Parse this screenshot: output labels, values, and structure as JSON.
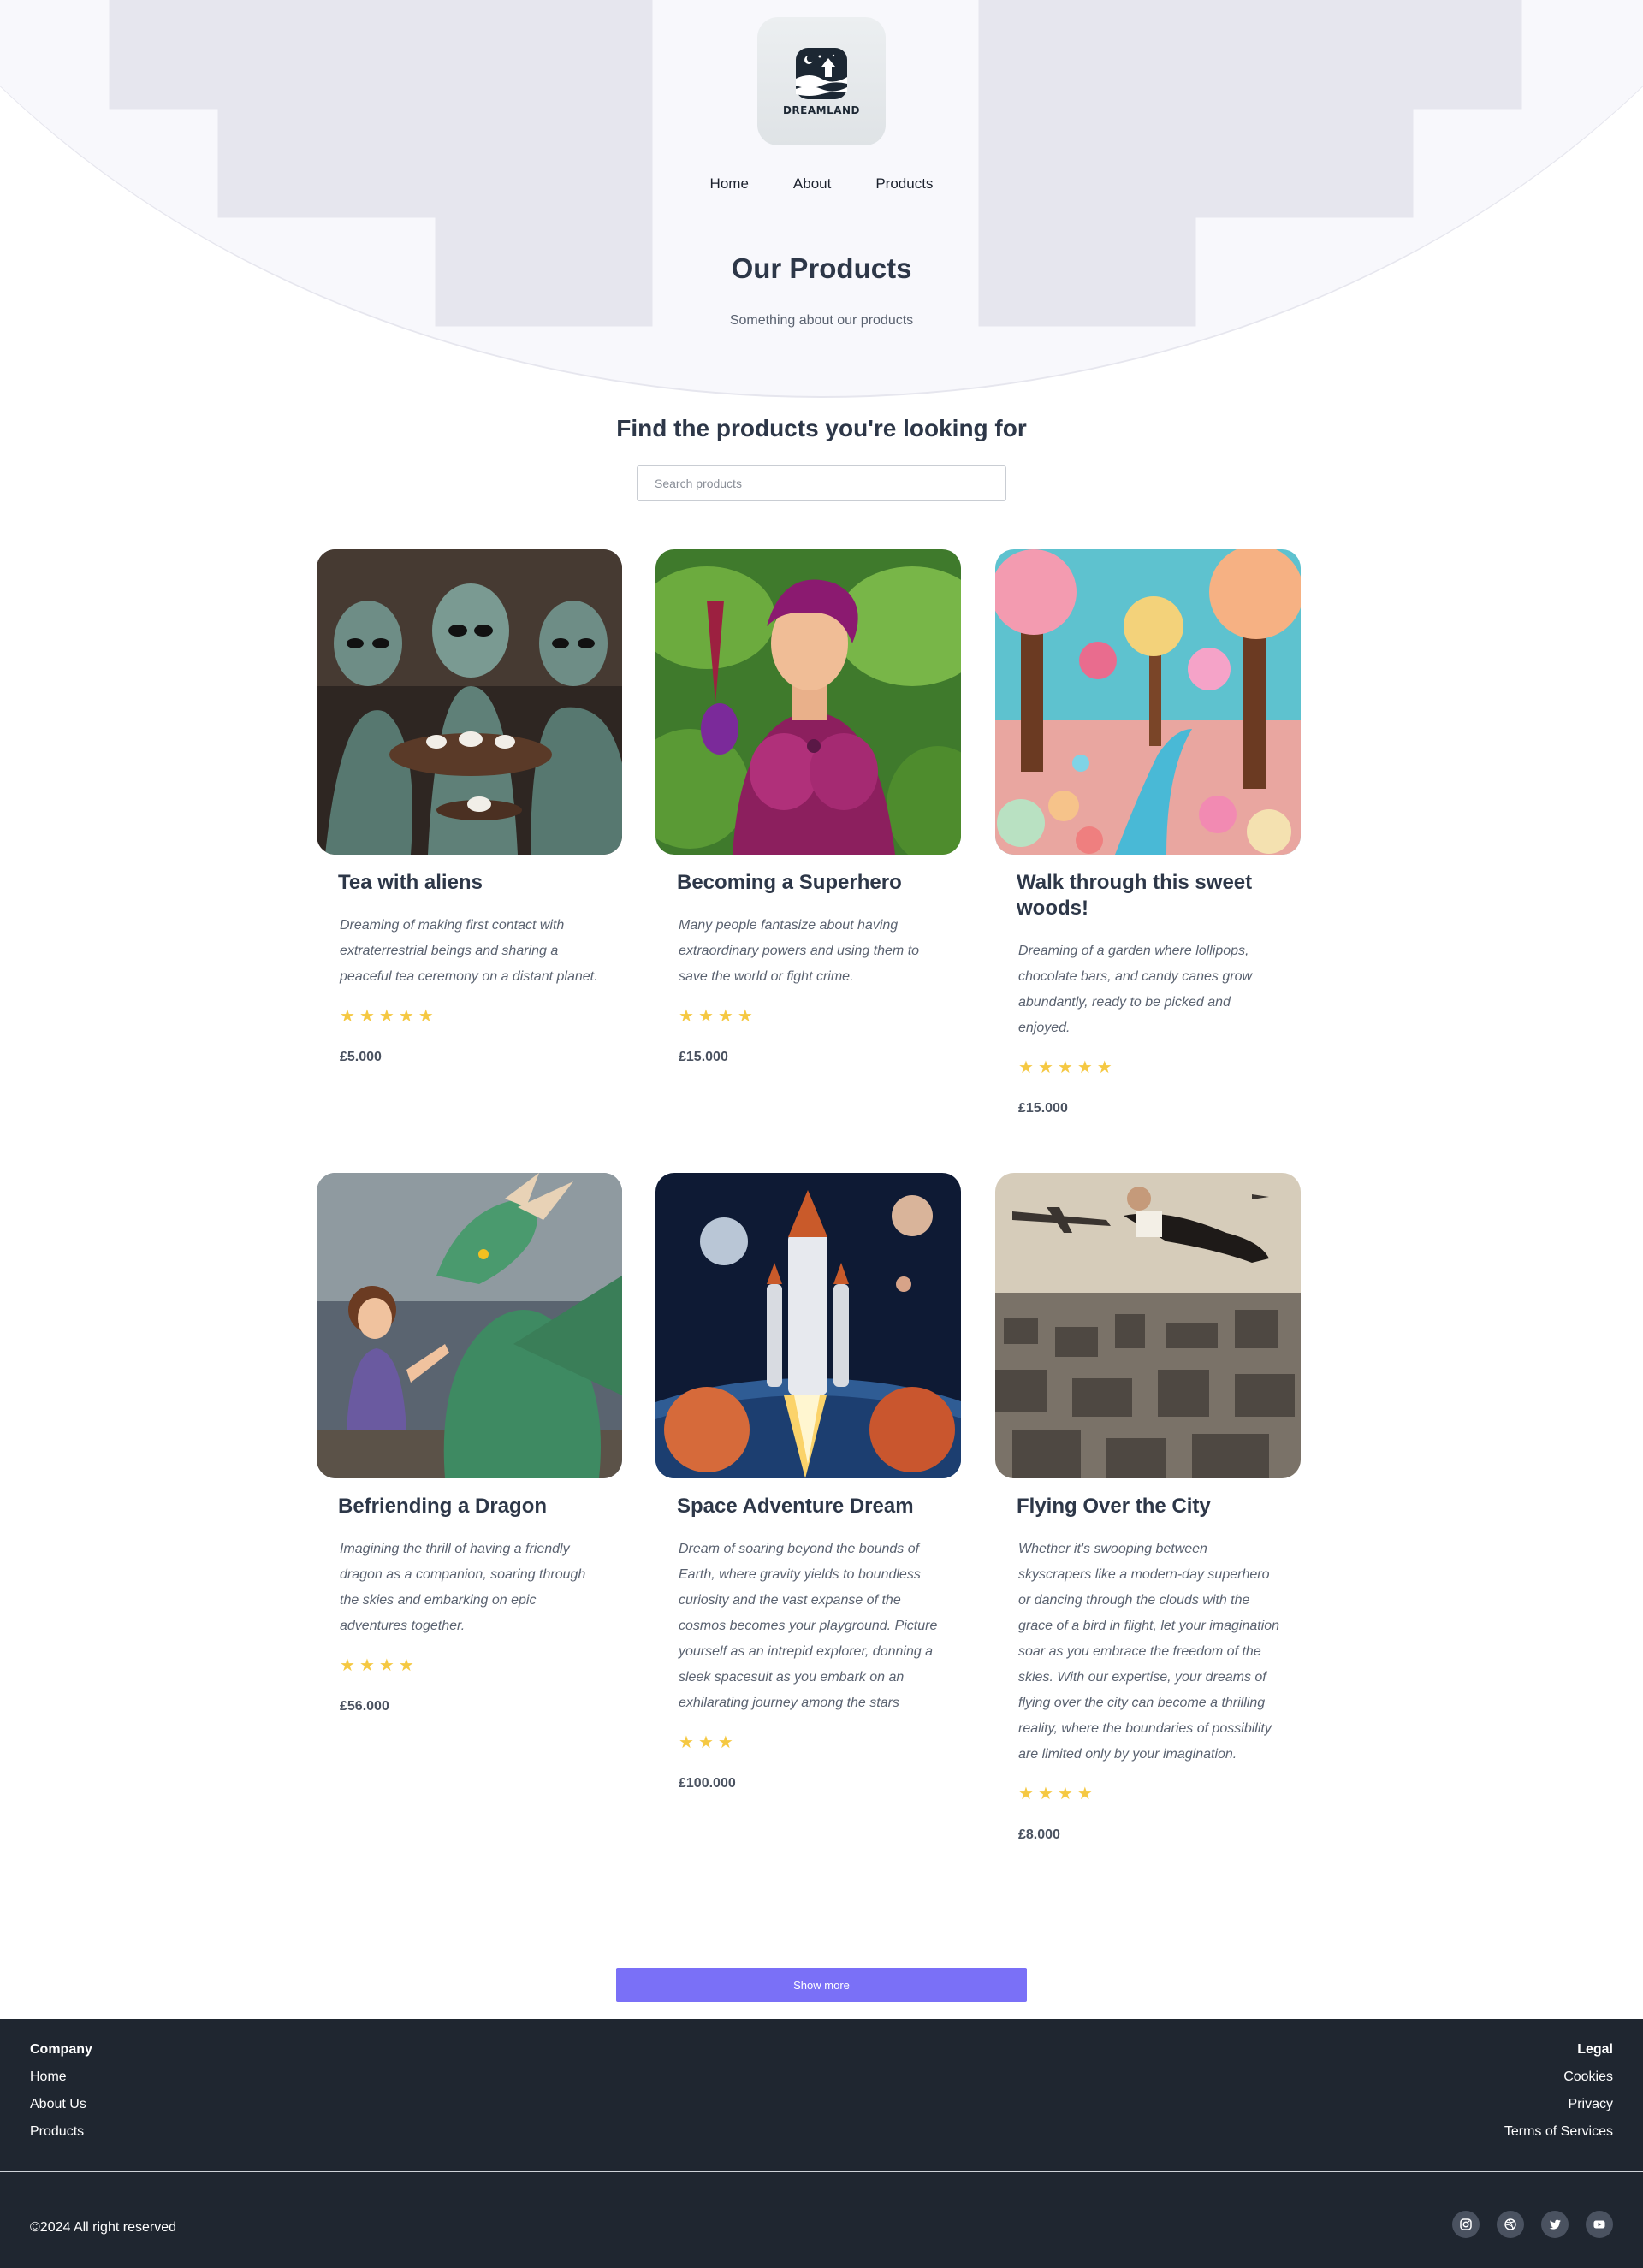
{
  "brand": {
    "logo_text": "DREAMLAND"
  },
  "nav": {
    "items": [
      "Home",
      "About",
      "Products"
    ]
  },
  "hero": {
    "title": "Our Products",
    "subtitle": "Something about our products"
  },
  "search": {
    "heading": "Find the products you're looking for",
    "placeholder": "Search products",
    "value": ""
  },
  "products": [
    {
      "title": "Tea with aliens",
      "description": "Dreaming of making first contact with extraterrestrial beings and sharing a peaceful tea ceremony on a distant planet.",
      "rating": 5,
      "price": "£5.000",
      "image": "alien-tea-party-image"
    },
    {
      "title": "Becoming a Superhero",
      "description": "Many people fantasize about having extraordinary powers and using them to save the world or fight crime.",
      "rating": 4,
      "price": "£15.000",
      "image": "purple-superhero-image"
    },
    {
      "title": "Walk through this sweet woods!",
      "description": "Dreaming of a garden where lollipops, chocolate bars, and candy canes grow abundantly, ready to be picked and enjoyed.",
      "rating": 5,
      "price": "£15.000",
      "image": "candy-forest-image"
    },
    {
      "title": "Befriending a Dragon",
      "description": "Imagining the thrill of having a friendly dragon as a companion, soaring through the skies and embarking on epic adventures together.",
      "rating": 4,
      "price": "£56.000",
      "image": "girl-and-dragon-image"
    },
    {
      "title": "Space Adventure Dream",
      "description": "Dream of soaring beyond the bounds of Earth, where gravity yields to boundless curiosity and the vast expanse of the cosmos becomes your playground. Picture yourself as an intrepid explorer, donning a sleek spacesuit as you embark on an exhilarating journey among the stars",
      "rating": 3,
      "price": "£100.000",
      "image": "rocket-launch-image"
    },
    {
      "title": "Flying Over the City",
      "description": "Whether it's swooping between skyscrapers like a modern-day superhero or dancing through the clouds with the grace of a bird in flight, let your imagination soar as you embrace the freedom of the skies. With our expertise, your dreams of flying over the city can become a thrilling reality, where the boundaries of possibility are limited only by your imagination.",
      "rating": 4,
      "price": "£8.000",
      "image": "man-flying-over-city-image"
    }
  ],
  "show_more_label": "Show more",
  "footer": {
    "company": {
      "heading": "Company",
      "links": [
        "Home",
        "About Us",
        "Products"
      ]
    },
    "legal": {
      "heading": "Legal",
      "links": [
        "Cookies",
        "Privacy",
        "Terms of Services"
      ]
    },
    "copyright": "©2024 All right reserved",
    "socials": [
      "instagram-icon",
      "dribbble-icon",
      "twitter-icon",
      "youtube-icon"
    ]
  },
  "colors": {
    "accent": "#7a70f7",
    "footer_bg": "#1f2630",
    "star": "#f5c842",
    "hero_bg": "#f8f8fc"
  }
}
